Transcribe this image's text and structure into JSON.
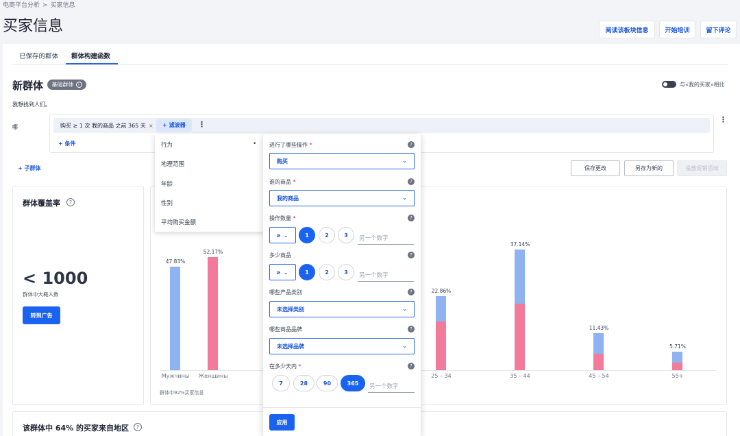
{
  "breadcrumb": {
    "parent": "电商平台分析",
    "separator": ">",
    "current": "买家信息"
  },
  "page_title": "买家信息",
  "header_buttons": {
    "read_block": "阅读该板块信息",
    "start_training": "开始培训",
    "leave_comment": "留下评论"
  },
  "tabs": [
    {
      "label": "已保存的群体"
    },
    {
      "label": "群体构建函数"
    }
  ],
  "segment": {
    "title": "新群体",
    "badge": "基础群体",
    "badge_info": "i",
    "compare_label": "与«我的买家»相比",
    "intro": "我想找到人们。",
    "who_label": "哪",
    "condition_chip": "购买 ≥ 1 次 我的商品 之前 365 天",
    "condition_chip_remove": "×",
    "filter_button": "+ 滤波器",
    "kebab": "⋮",
    "add_condition": "+ 条件",
    "add_subgroup": "+ 子群体",
    "save_changes": "保存更改",
    "save_as_new": "另存为新的",
    "run_campaign": "投放促销活动"
  },
  "coverage": {
    "title": "群体覆盖率",
    "help": "?",
    "value": "< 1000",
    "sub": "群体中大概人数",
    "goto_ads": "转到广告"
  },
  "chart_data": [
    {
      "type": "bar",
      "categories": [
        "Мужчины",
        "Женщины"
      ],
      "values": [
        47.83,
        52.17
      ],
      "colors": [
        "#8fb2f0",
        "#f27b9b"
      ],
      "ylim": [
        0,
        60
      ],
      "data_labels": [
        "47.83%",
        "52.17%"
      ],
      "note": "群体中92%买家信息"
    },
    {
      "type": "bar",
      "stacked": true,
      "categories": [
        "25 – 34",
        "35 – 44",
        "45 – 54",
        "55+"
      ],
      "values": [
        22.86,
        37.14,
        11.43,
        5.71
      ],
      "series": [
        {
          "color": "#f27b9b",
          "values": [
            15.0,
            20.4,
            5.0,
            2.4
          ]
        },
        {
          "color": "#8fb2f0",
          "values": [
            7.86,
            16.74,
            6.43,
            3.31
          ]
        }
      ],
      "data_labels": [
        "22.86%",
        "37.14%",
        "11.43%",
        "5.71%"
      ],
      "ylim": [
        0,
        40
      ]
    }
  ],
  "region": {
    "title": "该群体中 64% 的买家来自地区",
    "help": "?"
  },
  "filter_menu": {
    "items": [
      "行为",
      "地理范围",
      "年龄",
      "性别",
      "平均购买金额"
    ],
    "marker": "•"
  },
  "filter_popover": {
    "help": "?",
    "required_mark": "*",
    "operation_label": "进行了哪些操作",
    "operation_value": "购买",
    "product_owner_label": "谁的商品",
    "product_owner_value": "我的商品",
    "count_label": "操作数量",
    "count_op": "≥",
    "count_options": [
      "1",
      "2",
      "3"
    ],
    "count_selected": "1",
    "other_number_placeholder": "另一个数字",
    "items_label": "多少商品",
    "items_op": "≥",
    "items_options": [
      "1",
      "2",
      "3"
    ],
    "category_label": "哪些产品类别",
    "category_value": "未选择类别",
    "brand_label": "哪些商品品牌",
    "brand_value": "未选择品牌",
    "days_label": "在多少天内",
    "days_options": [
      "7",
      "28",
      "90",
      "365"
    ],
    "days_selected": "365",
    "apply": "应用"
  },
  "icons": {
    "chevron_down": "chevron-down-icon",
    "help": "help-icon",
    "kebab": "kebab-icon"
  },
  "colors": {
    "accent": "#1a63f0",
    "bar_blue": "#8fb2f0",
    "bar_pink": "#f27b9b"
  }
}
